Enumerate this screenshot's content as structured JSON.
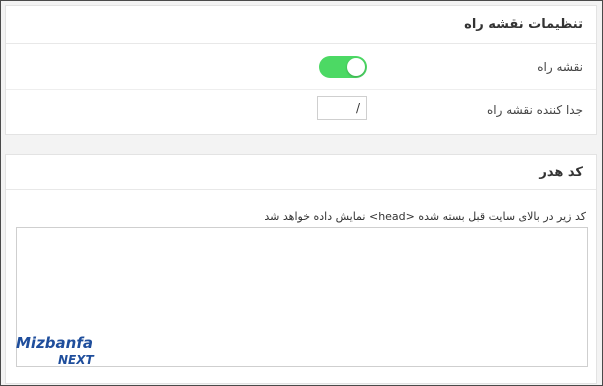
{
  "roadmap_settings": {
    "title": "تنظیمات نقشه راه",
    "roadmap_label": "نقشه راه",
    "roadmap_enabled": true,
    "separator_label": "جدا کننده نقشه راه",
    "separator_value": "/"
  },
  "header_code": {
    "title": "کد هدر",
    "helper_text": "کد زیر در بالای سایت قبل بسته شده <head> نمایش داده خواهد شد",
    "code_value": ""
  },
  "watermark": {
    "line1": "Mizbanfa",
    "line2": "NEXT",
    "color_primary": "#1f4e9c",
    "color_accent": "#2aa8d8"
  },
  "colors": {
    "toggle_on": "#4cd964"
  }
}
